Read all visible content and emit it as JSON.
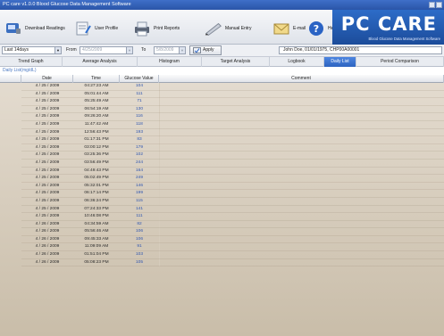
{
  "window": {
    "title": "PC care v1.0.0 Blood Glucose Data Management Software"
  },
  "toolbar": {
    "download": "Download Readings",
    "profile": "User Profile",
    "print": "Print Reports",
    "manual": "Manual Entry",
    "email": "E-mail",
    "help": "Help"
  },
  "brand": {
    "logo": "PC CARE",
    "tagline": "Blood Glucose Data Management Software"
  },
  "filters": {
    "period": "Last 14days",
    "from_label": "From",
    "from_value": "4/25/2009",
    "to_label": "To",
    "to_value": "5/8/2009",
    "apply": "Apply",
    "patient": "John Doe, 01/01/1975, CHP00A00001"
  },
  "tabs": [
    "Trend Graph",
    "Average Analysis",
    "Histogram",
    "Target Analysis",
    "Logbook",
    "Daily List",
    "Period Comparison"
  ],
  "active_tab": "Daily List",
  "section_title": "Daily List(mg/dL)",
  "table": {
    "headers": [
      "Date",
      "Time",
      "Glucose Value",
      "Comment"
    ],
    "rows": [
      {
        "date": "4 / 25 / 2009",
        "time": "04:27:23 AM",
        "value": "104"
      },
      {
        "date": "4 / 25 / 2009",
        "time": "05:01:44 AM",
        "value": "111"
      },
      {
        "date": "4 / 25 / 2009",
        "time": "05:25:49 AM",
        "value": "71"
      },
      {
        "date": "4 / 25 / 2009",
        "time": "06:54:19 AM",
        "value": "130"
      },
      {
        "date": "4 / 25 / 2009",
        "time": "09:26:20 AM",
        "value": "116"
      },
      {
        "date": "4 / 25 / 2009",
        "time": "11:47:42 AM",
        "value": "118"
      },
      {
        "date": "4 / 25 / 2009",
        "time": "12:56:43 PM",
        "value": "193"
      },
      {
        "date": "4 / 25 / 2009",
        "time": "01:17:31 PM",
        "value": "83"
      },
      {
        "date": "4 / 25 / 2009",
        "time": "03:00:12 PM",
        "value": "179"
      },
      {
        "date": "4 / 25 / 2009",
        "time": "03:25:36 PM",
        "value": "102"
      },
      {
        "date": "4 / 25 / 2009",
        "time": "03:56:49 PM",
        "value": "244"
      },
      {
        "date": "4 / 25 / 2009",
        "time": "04:49:43 PM",
        "value": "164"
      },
      {
        "date": "4 / 25 / 2009",
        "time": "05:02:49 PM",
        "value": "249"
      },
      {
        "date": "4 / 25 / 2009",
        "time": "05:32:01 PM",
        "value": "146"
      },
      {
        "date": "4 / 25 / 2009",
        "time": "06:17:14 PM",
        "value": "199"
      },
      {
        "date": "4 / 25 / 2009",
        "time": "06:36:24 PM",
        "value": "115"
      },
      {
        "date": "4 / 25 / 2009",
        "time": "07:24:33 PM",
        "value": "141"
      },
      {
        "date": "4 / 25 / 2009",
        "time": "10:46:08 PM",
        "value": "111"
      },
      {
        "date": "4 / 26 / 2009",
        "time": "04:34:59 AM",
        "value": "82"
      },
      {
        "date": "4 / 26 / 2009",
        "time": "05:56:46 AM",
        "value": "106"
      },
      {
        "date": "4 / 26 / 2009",
        "time": "09:45:33 AM",
        "value": "106"
      },
      {
        "date": "4 / 26 / 2009",
        "time": "11:09:09 AM",
        "value": "91"
      },
      {
        "date": "4 / 26 / 2009",
        "time": "01:51:04 PM",
        "value": "103"
      },
      {
        "date": "4 / 26 / 2009",
        "time": "05:08:23 PM",
        "value": "105"
      }
    ]
  },
  "colors": {
    "accent": "#2c63c0",
    "value_text": "#2f56b0",
    "grid_bg": "#d9cfbf"
  }
}
